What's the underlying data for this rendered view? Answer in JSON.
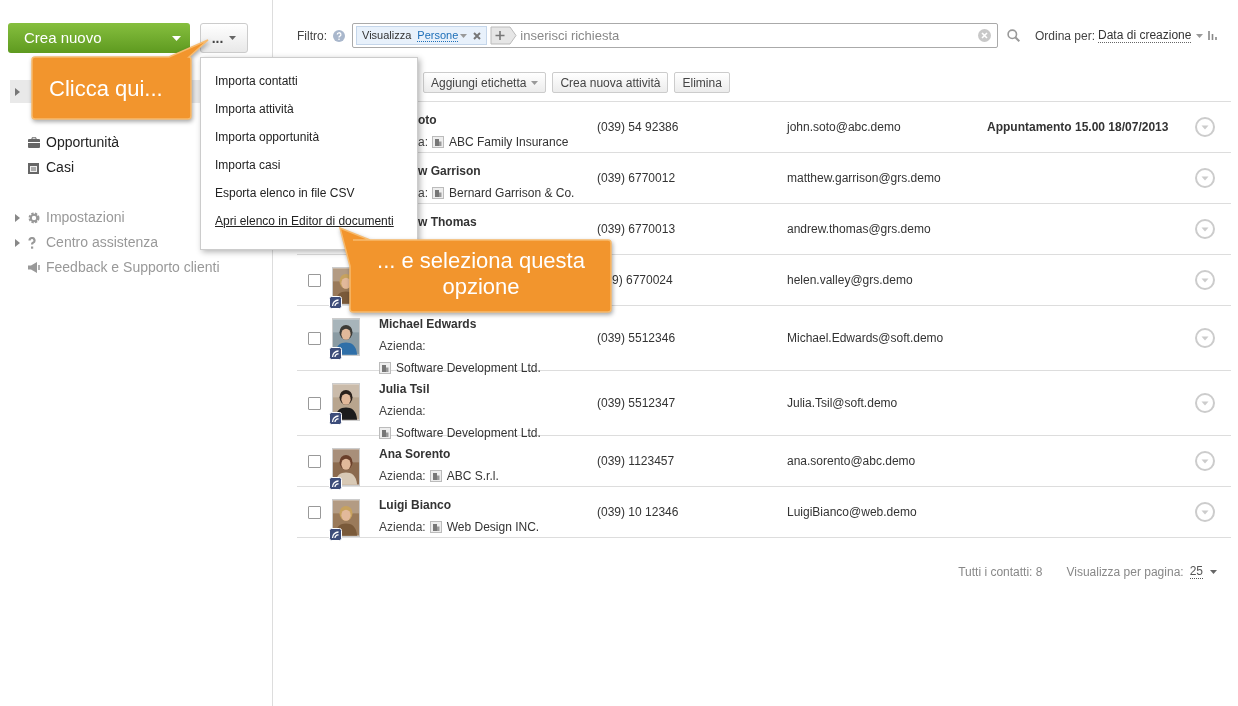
{
  "sidebar": {
    "create_button": "Crea nuovo",
    "more_button": "...",
    "items": [
      {
        "label": "Opportunità",
        "kind": "main",
        "expandable": false
      },
      {
        "label": "Casi",
        "kind": "main",
        "expandable": false
      },
      {
        "label": "Impostazioni",
        "kind": "tool",
        "expandable": true
      },
      {
        "label": "Centro assistenza",
        "kind": "tool",
        "expandable": true
      },
      {
        "label": "Feedback e Supporto clienti",
        "kind": "tool",
        "expandable": false
      }
    ]
  },
  "filter": {
    "label": "Filtro:",
    "tag_name": "Visualizza",
    "tag_value": "Persone",
    "placeholder": "inserisci richiesta"
  },
  "sort": {
    "label": "Ordina per:",
    "value": "Data di creazione"
  },
  "toolbar": [
    {
      "label": "Aggiungi etichetta",
      "dropdown": true
    },
    {
      "label": "Crea nuova attività",
      "dropdown": false
    },
    {
      "label": "Elimina",
      "dropdown": false
    }
  ],
  "rows": [
    {
      "name": "oto",
      "company_label": "a:",
      "company": "ABC Family Insurance",
      "phone": "(039) 54 92386",
      "email": "john.soto@abc.demo",
      "note": "Appuntamento 15.00 18/07/2013"
    },
    {
      "name": "w Garrison",
      "company_label": "a:",
      "company": "Bernard Garrison & Co.",
      "phone": "(039) 6770012",
      "email": "matthew.garrison@grs.demo"
    },
    {
      "name": "w Thomas",
      "phone": "(039) 6770013",
      "email": "andrew.thomas@grs.demo"
    },
    {
      "checked": false,
      "phone": "9) 6770024",
      "email": "helen.valley@grs.demo"
    },
    {
      "checked": false,
      "name": "Michael Edwards",
      "company_label": "Azienda:",
      "company": "Software Development Ltd.",
      "company_on_new_line": true,
      "phone": "(039) 5512346",
      "email": "Michael.Edwards@soft.demo"
    },
    {
      "checked": false,
      "name": "Julia Tsil",
      "company_label": "Azienda:",
      "company": "Software Development Ltd.",
      "company_on_new_line": true,
      "phone": "(039) 5512347",
      "email": "Julia.Tsil@soft.demo"
    },
    {
      "checked": false,
      "name": "Ana Sorento",
      "company_label": "Azienda:",
      "company": "ABC S.r.l.",
      "phone": "(039) 1123457",
      "email": "ana.sorento@abc.demo"
    },
    {
      "checked": false,
      "name": "Luigi Bianco",
      "company_label": "Azienda:",
      "company": "Web Design INC.",
      "phone": "(039) 10 12346",
      "email": "LuigiBianco@web.demo"
    }
  ],
  "footer": {
    "total": "Tutti i contatti: 8",
    "per_page_label": "Visualizza per pagina:",
    "per_page": "25"
  },
  "menu": {
    "items": [
      {
        "label": "Importa contatti",
        "highlighted": false
      },
      {
        "label": "Importa attività",
        "highlighted": false
      },
      {
        "label": "Importa opportunità",
        "highlighted": false
      },
      {
        "label": "Importa casi",
        "highlighted": false
      },
      {
        "label": "Esporta elenco in file CSV",
        "highlighted": false
      },
      {
        "label": "Apri elenco in Editor di documenti",
        "highlighted": true
      }
    ]
  },
  "callouts": [
    "Clicca qui...",
    "... e seleziona questa opzione"
  ]
}
